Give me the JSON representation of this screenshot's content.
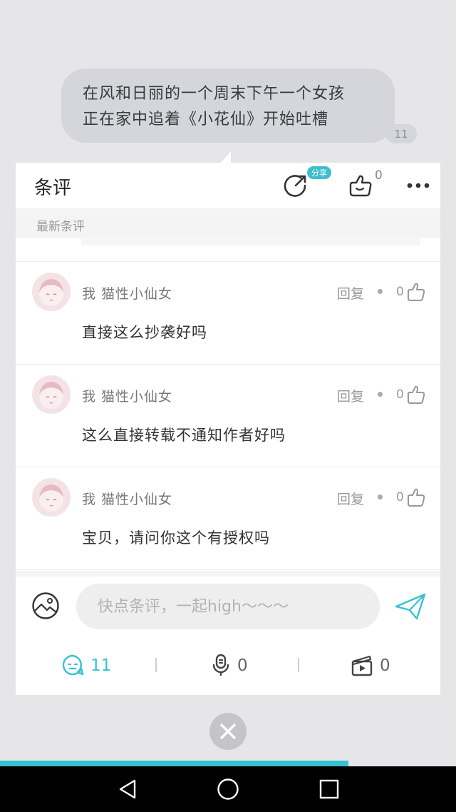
{
  "quote": {
    "lines": [
      "在风和日丽的一个周末下午一个女孩",
      "正在家中追着《小花仙》开始吐槽"
    ],
    "count": "11"
  },
  "panel": {
    "title": "条评",
    "share_badge": "分享",
    "like_count": "0",
    "section_label": "最新条评"
  },
  "comments": [
    {
      "user": "我  猫性小仙女",
      "reply_label": "回复",
      "likes": "0",
      "text": "直接这么抄袭好吗"
    },
    {
      "user": "我  猫性小仙女",
      "reply_label": "回复",
      "likes": "0",
      "text": "这么直接转载不通知作者好吗"
    },
    {
      "user": "我  猫性小仙女",
      "reply_label": "回复",
      "likes": "0",
      "text": "宝贝，请问你这个有授权吗"
    }
  ],
  "input": {
    "placeholder": "快点条评，一起high～～～"
  },
  "stats": {
    "comments": "11",
    "voice": "0",
    "video": "0"
  },
  "progress": {
    "fraction": 0.764
  },
  "colors": {
    "accent": "#36c2d0",
    "panel_bg": "#ffffff",
    "backdrop": "#e6e6e8"
  },
  "icons": [
    "share-icon",
    "like-icon",
    "more-icon",
    "image-icon",
    "send-icon",
    "comment-icon",
    "microphone-icon",
    "video-icon",
    "close-icon",
    "back-icon",
    "home-icon",
    "recents-icon"
  ]
}
